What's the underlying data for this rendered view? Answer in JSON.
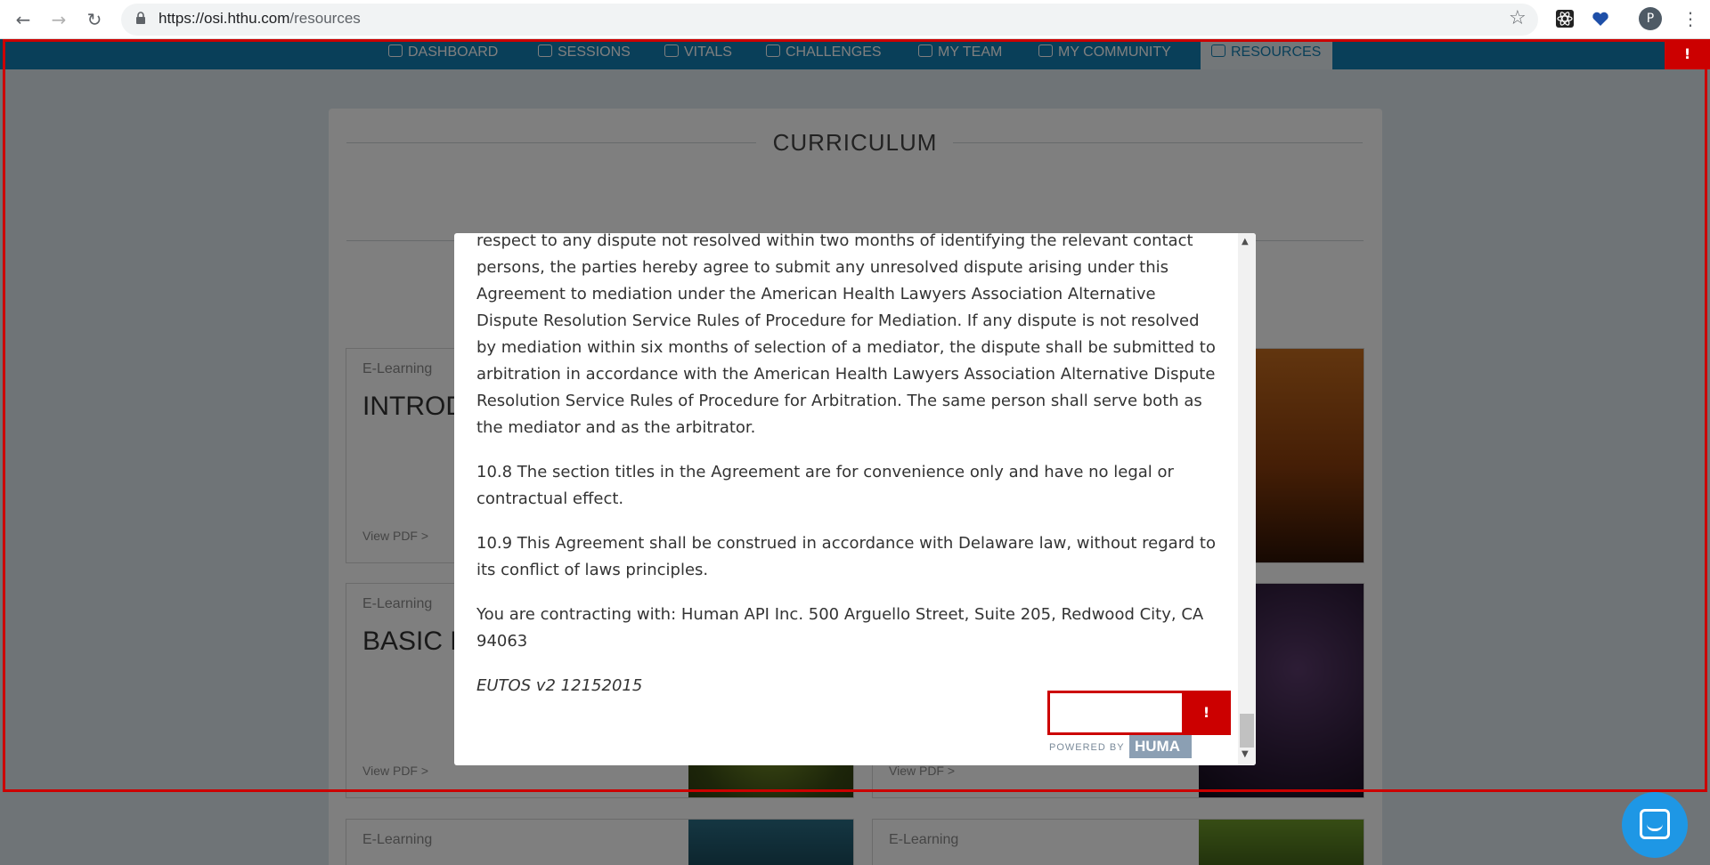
{
  "browser": {
    "url_host": "https://osi.hthu.com",
    "url_path": "/resources",
    "avatar_letter": "P"
  },
  "topnav": {
    "items": [
      {
        "label": "DASHBOARD",
        "icon": "home-icon"
      },
      {
        "label": "SESSIONS",
        "icon": "calendar-icon"
      },
      {
        "label": "VITALS",
        "icon": "heart-icon"
      },
      {
        "label": "CHALLENGES",
        "icon": "chart-icon"
      },
      {
        "label": "MY TEAM",
        "icon": "team-icon"
      },
      {
        "label": "MY COMMUNITY",
        "icon": "lightbulb-icon"
      },
      {
        "label": "RESOURCES",
        "icon": "resources-icon"
      }
    ],
    "active": "RESOURCES"
  },
  "curriculum": {
    "title": "CURRICULUM",
    "tiles": [
      {
        "tag": "E-Learning",
        "title": "INTROD",
        "link": "View PDF >"
      },
      {
        "tag": "E-Learning",
        "title": "BASIC N",
        "link": "View PDF >"
      },
      {
        "tag": "E-Learning",
        "title": "",
        "link": "View PDF >"
      },
      {
        "tag": "E-Learning",
        "title": "",
        "link": ""
      },
      {
        "tag": "E-Learning",
        "title": "",
        "link": ""
      }
    ]
  },
  "modal": {
    "paragraphs": [
      "respect to any dispute not resolved within two months of identifying the relevant contact persons, the parties hereby agree to submit any unresolved dispute arising under this Agreement to mediation under the American Health Lawyers Association Alternative Dispute Resolution Service Rules of Procedure for Mediation. If any dispute is not resolved by mediation within six months of selection of a mediator, the dispute shall be submitted to arbitration in accordance with the American Health Lawyers Association Alternative Dispute Resolution Service Rules of Procedure for Arbitration. The same person shall serve both as the mediator and as the arbitrator.",
      "10.8 The section titles in the Agreement are for convenience only and have no legal or contractual effect.",
      "10.9 This Agreement shall be construed in accordance with Delaware law, without regard to its conflict of laws principles.",
      "You are contracting with: Human API Inc. 500 Arguello Street, Suite 205, Redwood City, CA 94063"
    ],
    "version": "EUTOS v2 12152015",
    "powered_by": "POWERED BY",
    "brand": "HUMA"
  },
  "flags": {
    "top": "!",
    "powered": "!"
  },
  "colors": {
    "nav_blue": "#127fb3",
    "flag_red": "#cc0000",
    "chat_blue": "#1e97e5"
  }
}
